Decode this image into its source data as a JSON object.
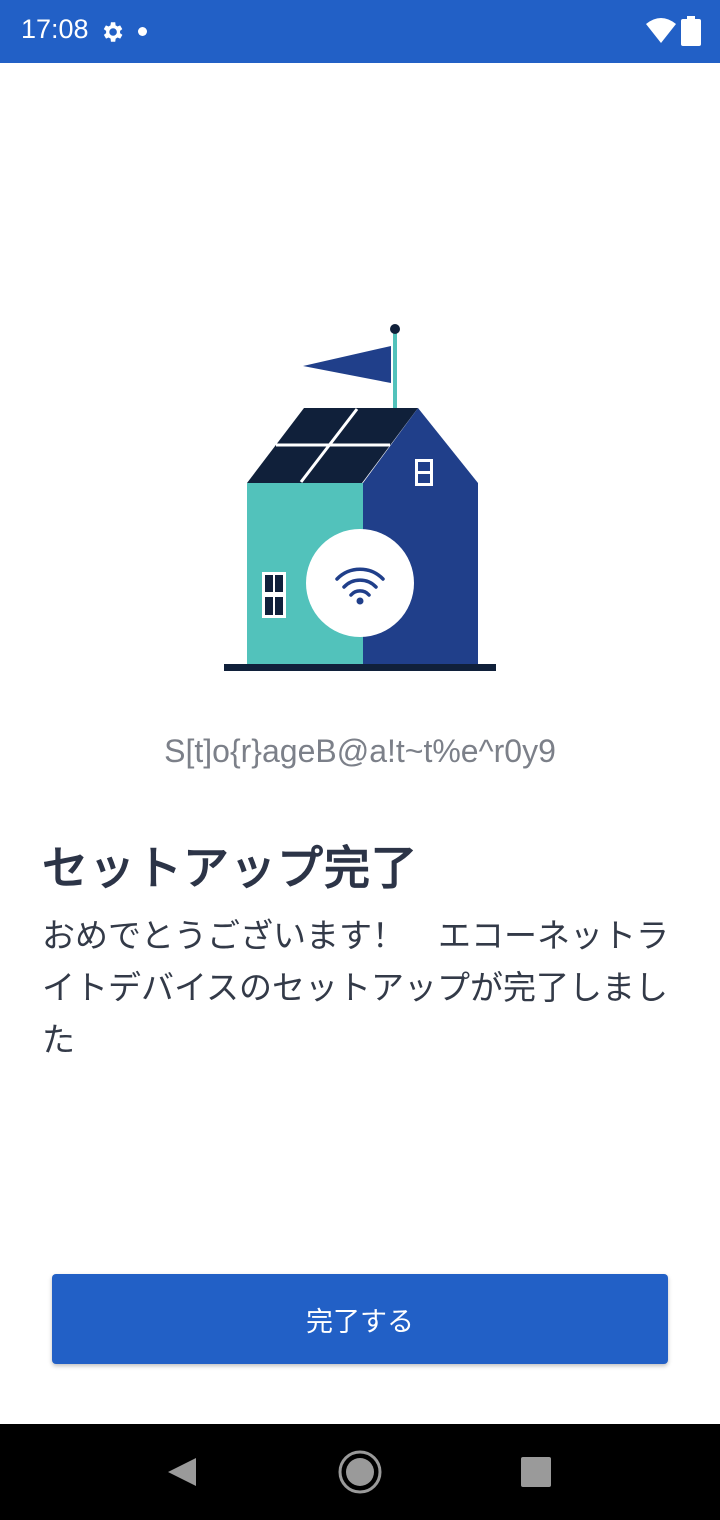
{
  "status_bar": {
    "time": "17:08",
    "background": "#2260c6",
    "icons": [
      "gear-icon",
      "notification-dot-icon",
      "wifi-icon",
      "battery-icon"
    ]
  },
  "illustration": {
    "icon": "smart-home-wifi-illustration",
    "colors": {
      "teal": "#52c2bb",
      "navy": "#203f8a",
      "dark": "#10203a"
    }
  },
  "device": {
    "name": "S[t]o{r}ageB@a!t~t%e^r0y9"
  },
  "setup": {
    "title": "セットアップ完了",
    "message": "おめでとうございます！　エコーネットライトデバイスのセットアップが完了しました"
  },
  "actions": {
    "done_label": "完了する",
    "accent": "#2260c6"
  },
  "nav_bar": {
    "icons": [
      "back-icon",
      "home-icon",
      "recents-icon"
    ]
  }
}
